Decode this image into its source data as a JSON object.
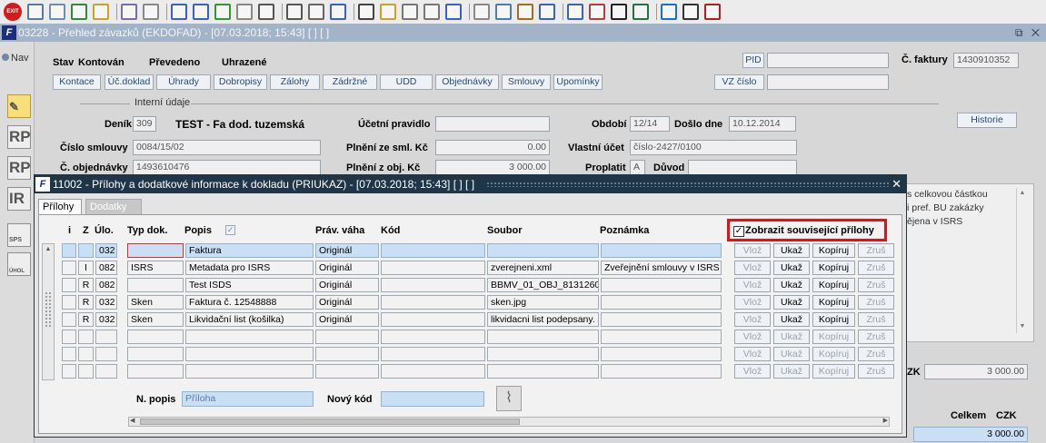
{
  "toolbar": {
    "exit_label": "EXIT",
    "icons": [
      "back-icon",
      "forward-icon",
      "tree-icon",
      "save-icon",
      "copy-icon",
      "cut-icon",
      "sort-asc-icon",
      "sort-desc-icon",
      "check-icon",
      "wrench-icon",
      "filter-icon",
      "print-icon",
      "print-preview-icon",
      "mail-icon",
      "scissors-icon",
      "paste-icon",
      "find-icon",
      "find-replace-icon",
      "export-icon",
      "calculator-icon",
      "globe-icon",
      "helm-icon",
      "mountain-icon",
      "chart-icon",
      "clock-icon",
      "sigma-icon",
      "excel-icon",
      "ie-icon",
      "help-icon",
      "info-icon"
    ]
  },
  "window": {
    "title": "03228 - Přehled závazků (EKDOFAD) - [07.03.2018; 15:43] [ ] [ ]",
    "controls": "⧉ ✕"
  },
  "left": {
    "nav_label": "Nav",
    "icons": [
      "RP",
      "RP",
      "IR",
      "SPS",
      "ÚHOL"
    ]
  },
  "main": {
    "status": {
      "stav_label": "Stav",
      "kontovan": "Kontován",
      "prevedeno": "Převedeno",
      "uhrazene": "Uhrazené"
    },
    "tabs": [
      "Kontace",
      "Úč.doklad",
      "Úhrady",
      "Dobropisy",
      "Zálohy",
      "Zádržné",
      "UDD",
      "Objednávky",
      "Smlouvy",
      "Upomínky"
    ],
    "pid_label": "PID",
    "vz_label": "VZ číslo",
    "faktura_label": "Č. faktury",
    "faktura_value": "1430910352",
    "interni_label": "Interní údaje",
    "historie": "Historie",
    "denik_label": "Deník",
    "denik_value": "309",
    "denik_name": "TEST - Fa dod. tuzemská",
    "ucetni_label": "Účetní pravidlo",
    "obdobi_label": "Období",
    "obdobi_value": "12/14",
    "doslo_label": "Došlo dne",
    "doslo_value": "10.12.2014",
    "smlouvy_label": "Číslo smlouvy",
    "smlouvy_value": "0084/15/02",
    "plneni_sml_label": "Plnění ze sml. Kč",
    "plneni_sml_value": "0.00",
    "vlastni_label": "Vlastní účet",
    "vlastni_value": "číslo-2427/0100",
    "obj_label": "Č. objednávky",
    "obj_value": "1493610476",
    "plneni_obj_label": "Plnění z obj. Kč",
    "plneni_obj_value": "3 000.00",
    "proplatit_label": "Proplatit",
    "proplatit_value": "A",
    "duvod_label": "Důvod",
    "right_text": "s celkovou částkou\ni pref. BU zakázky\nějena v ISRS",
    "czk_label": "ZK",
    "czk_value": "3 000.00",
    "celkem_label": "Celkem",
    "celkem_currency": "CZK",
    "celkem_value": "3 000.00"
  },
  "dialog": {
    "title": "11002 - Přílohy a dodatkové informace k dokladu (PRIUKAZ) - [07.03.2018; 15:43] [ ] [ ]",
    "tab_active": "Přílohy",
    "tab_inactive": "Dodatky",
    "headers": {
      "i": "i",
      "z": "Z",
      "ulo": "Úlo.",
      "typ": "Typ dok.",
      "popis": "Popis",
      "prav": "Práv. váha",
      "kod": "Kód",
      "soubor": "Soubor",
      "poznamka": "Poznámka"
    },
    "checkbox_label": "Zobrazit související přílohy",
    "checkbox_mark": "✓",
    "rows": [
      {
        "i": "",
        "z": "",
        "ulo": "032",
        "typ": "",
        "popis": "Faktura",
        "prav": "Originál",
        "kod": "",
        "soubor": "",
        "poznamka": ""
      },
      {
        "i": "",
        "z": "I",
        "ulo": "082",
        "typ": "ISRS",
        "popis": "Metadata pro ISRS",
        "prav": "Originál",
        "kod": "",
        "soubor": "zverejneni.xml",
        "poznamka": "Zveřejnění smlouvy v ISRS"
      },
      {
        "i": "",
        "z": "R",
        "ulo": "082",
        "typ": "",
        "popis": "Test ISDS",
        "prav": "Originál",
        "kod": "",
        "soubor": "BBMV_01_OBJ_8131260",
        "poznamka": ""
      },
      {
        "i": "",
        "z": "R",
        "ulo": "032",
        "typ": "Sken",
        "popis": "Faktura č. 12548888",
        "prav": "Originál",
        "kod": "",
        "soubor": "sken.jpg",
        "poznamka": ""
      },
      {
        "i": "",
        "z": "R",
        "ulo": "032",
        "typ": "Sken",
        "popis": "Likvidační list (košilka)",
        "prav": "Originál",
        "kod": "",
        "soubor": "likvidacni list podepsany.",
        "poznamka": ""
      },
      {
        "i": "",
        "z": "",
        "ulo": "",
        "typ": "",
        "popis": "",
        "prav": "",
        "kod": "",
        "soubor": "",
        "poznamka": ""
      },
      {
        "i": "",
        "z": "",
        "ulo": "",
        "typ": "",
        "popis": "",
        "prav": "",
        "kod": "",
        "soubor": "",
        "poznamka": ""
      },
      {
        "i": "",
        "z": "",
        "ulo": "",
        "typ": "",
        "popis": "",
        "prav": "",
        "kod": "",
        "soubor": "",
        "poznamka": ""
      }
    ],
    "row_buttons": {
      "vloz": "Vlož",
      "ukaz": "Ukaž",
      "kopiruj": "Kopíruj",
      "zrus": "Zruš"
    },
    "npopis_label": "N. popis",
    "npopis_value": "Příloha",
    "novy_kod_label": "Nový kód",
    "novy_kod_value": ""
  }
}
